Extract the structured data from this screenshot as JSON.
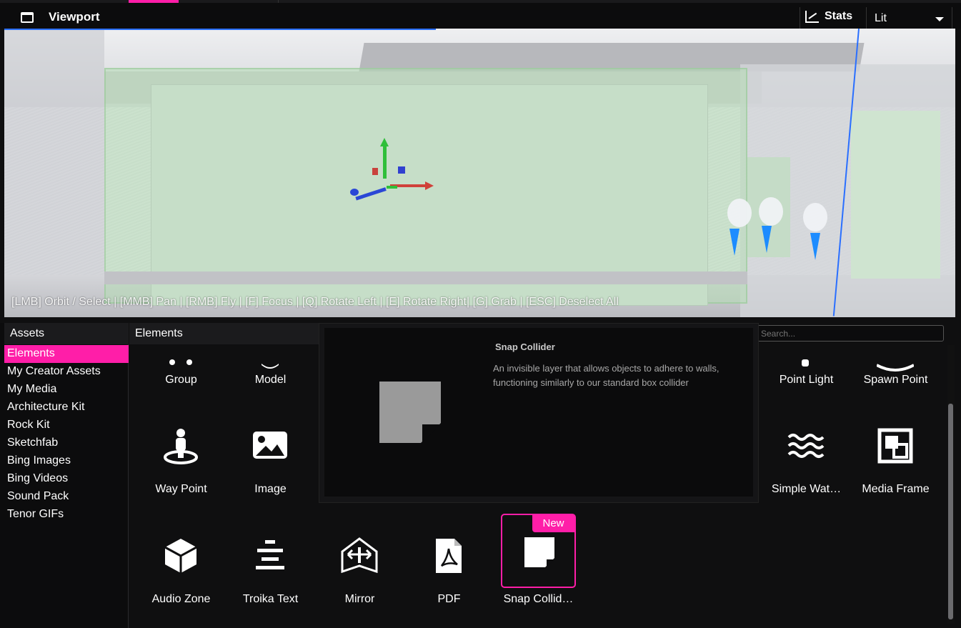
{
  "topbar": {
    "title": "Viewport",
    "stats_label": "Stats",
    "render_mode": "Lit"
  },
  "viewport": {
    "help_text": "[LMB] Orbit / Select | [MMB] Pan | [RMB] Fly | [F] Focus | [Q] Rotate Left | [E] Rotate Right| [G] Grab | [ESC] Deselect All"
  },
  "assets": {
    "header": "Assets",
    "items": [
      {
        "label": "Elements",
        "active": true
      },
      {
        "label": "My Creator Assets"
      },
      {
        "label": "My Media"
      },
      {
        "label": "Architecture Kit"
      },
      {
        "label": "Rock Kit"
      },
      {
        "label": "Sketchfab"
      },
      {
        "label": "Bing Images"
      },
      {
        "label": "Bing Videos"
      },
      {
        "label": "Sound Pack"
      },
      {
        "label": "Tenor GIFs"
      }
    ]
  },
  "elements": {
    "header": "Elements",
    "search_placeholder": "Search...",
    "tiles": [
      {
        "label": "Group",
        "icon": "group-icon"
      },
      {
        "label": "Model",
        "icon": "model-icon"
      },
      {
        "label": "Point Light",
        "icon": "point-light-icon"
      },
      {
        "label": "Spawn Point",
        "icon": "spawn-point-icon"
      },
      {
        "label": "Way Point",
        "icon": "way-point-icon"
      },
      {
        "label": "Image",
        "icon": "image-icon"
      },
      {
        "label": "Simple Wat…",
        "icon": "water-icon"
      },
      {
        "label": "Media Frame",
        "icon": "media-frame-icon"
      },
      {
        "label": "Audio Zone",
        "icon": "audio-zone-icon"
      },
      {
        "label": "Troika Text",
        "icon": "text-icon"
      },
      {
        "label": "Mirror",
        "icon": "mirror-icon"
      },
      {
        "label": "PDF",
        "icon": "pdf-icon"
      },
      {
        "label": "Snap Collid…",
        "icon": "snap-collider-icon",
        "badge": "New"
      }
    ]
  },
  "tooltip": {
    "title": "Snap Collider",
    "description": " An invisible layer that allows objects to adhere to walls, functioning similarly to our standard box collider"
  },
  "colors": {
    "accent": "#ff1ea8",
    "background": "#0f0f10"
  }
}
